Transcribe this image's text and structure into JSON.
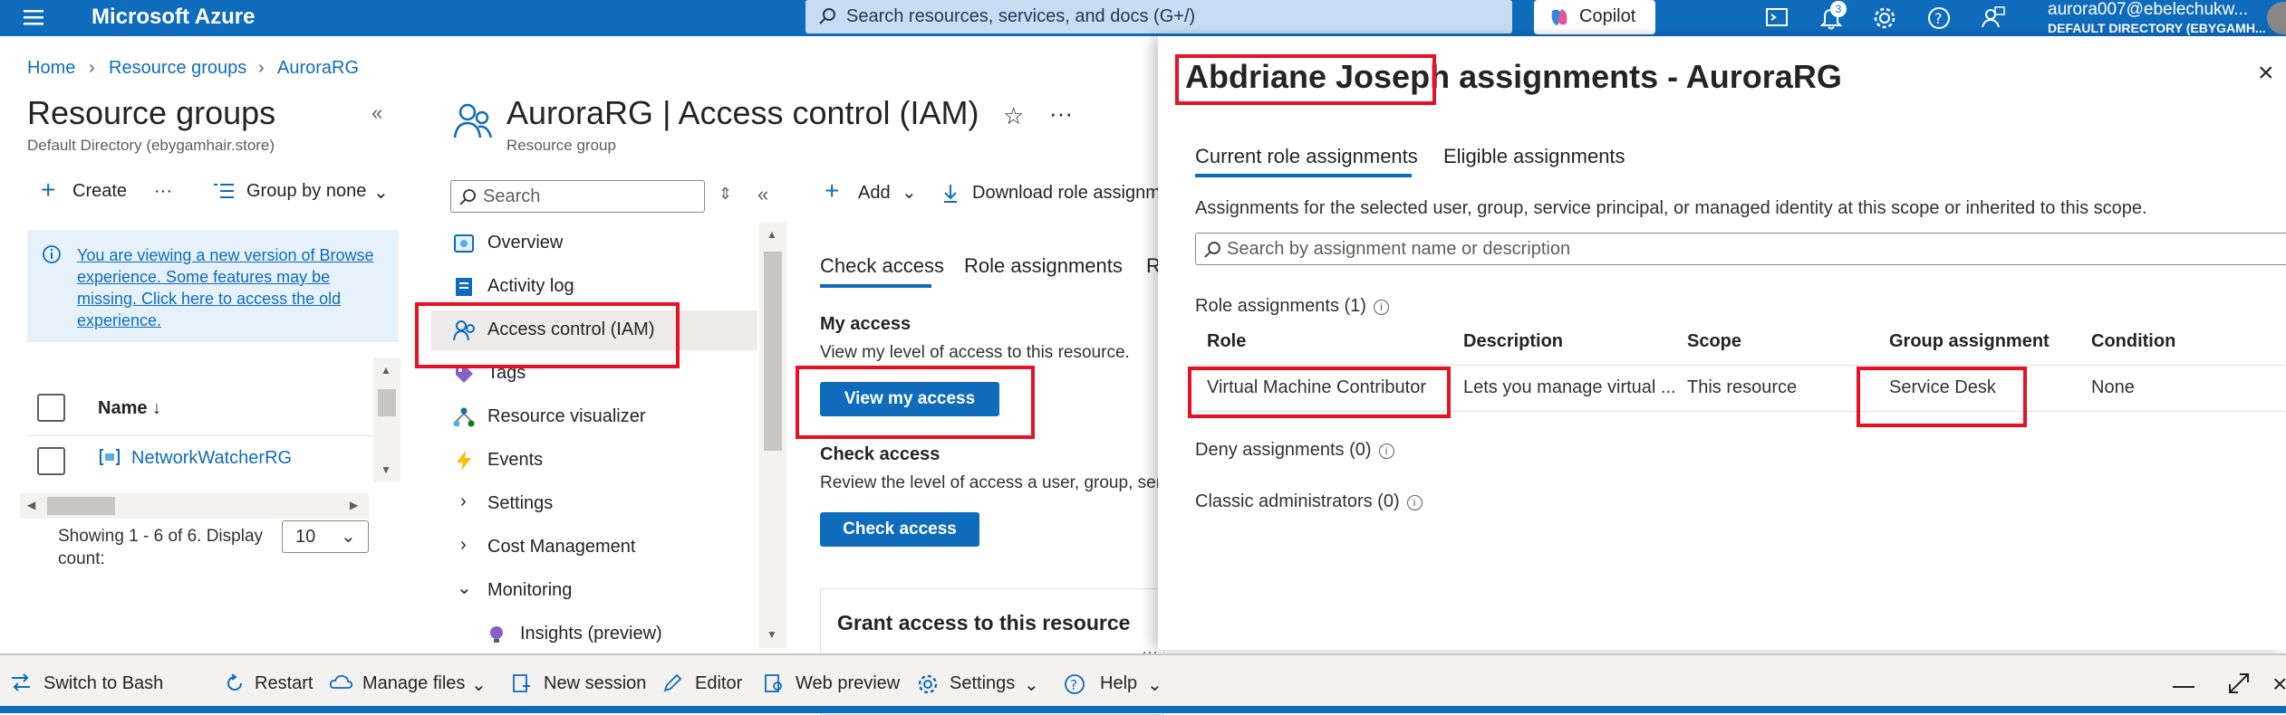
{
  "topbar": {
    "brand": "Microsoft Azure",
    "search_placeholder": "Search resources, services, and docs (G+/)",
    "copilot": "Copilot",
    "notification_count": "3",
    "account": "aurora007@ebelechukw...",
    "directory": "DEFAULT DIRECTORY (EBYGAMH..."
  },
  "breadcrumb": [
    "Home",
    "Resource groups",
    "AuroraRG"
  ],
  "left_blade": {
    "title": "Resource groups",
    "subtitle": "Default Directory (ebygamhair.store)",
    "create": "Create",
    "group_by": "Group by none",
    "info": "You are viewing a new version of Browse experience. Some features may be missing. Click here to access the old experience.",
    "col_name": "Name ↓",
    "rows": [
      "NetworkWatcherRG"
    ],
    "showing": "Showing 1 - 6 of 6. Display count:",
    "page_size": "10"
  },
  "mid_blade": {
    "title_name": "AuroraRG",
    "title_sep": " | ",
    "title_page": "Access control (IAM)",
    "subtitle": "Resource group",
    "search_placeholder": "Search",
    "nav": [
      {
        "label": "Overview"
      },
      {
        "label": "Activity log"
      },
      {
        "label": "Access control (IAM)"
      },
      {
        "label": "Tags"
      },
      {
        "label": "Resource visualizer"
      },
      {
        "label": "Events"
      },
      {
        "label": "Settings"
      },
      {
        "label": "Cost Management"
      },
      {
        "label": "Monitoring"
      },
      {
        "label": "Insights (preview)"
      }
    ]
  },
  "content": {
    "add": "Add",
    "download": "Download role assignme",
    "tabs": [
      "Check access",
      "Role assignments",
      "R"
    ],
    "my_access_h": "My access",
    "my_access_t": "View my level of access to this resource.",
    "view_btn": "View my access",
    "check_h": "Check access",
    "check_t": "Review the level of access a user, group, ser",
    "check_btn": "Check access",
    "grant": "Grant access to this resource"
  },
  "panel": {
    "title_name": "Abdriane Joseph",
    "title_rest": " assignments - AuroraRG",
    "tabs": [
      "Current role assignments",
      "Eligible assignments"
    ],
    "desc": "Assignments for the selected user, group, service principal, or managed identity at this scope or inherited to this scope.",
    "search_placeholder": "Search by assignment name or description",
    "role_assignments": "Role assignments (1)",
    "columns": [
      "Role",
      "Description",
      "Scope",
      "Group assignment",
      "Condition"
    ],
    "row": {
      "role": "Virtual Machine Contributor",
      "description": "Lets you manage virtual ...",
      "scope": "This resource",
      "group": "Service Desk",
      "condition": "None"
    },
    "deny": "Deny assignments (0)",
    "classic": "Classic administrators (0)"
  },
  "shell": {
    "switch": "Switch to Bash",
    "restart": "Restart",
    "manage_files": "Manage files",
    "new_session": "New session",
    "editor": "Editor",
    "web_preview": "Web preview",
    "settings": "Settings",
    "help": "Help"
  },
  "colors": {
    "azure_blue": "#0f6cbd",
    "highlight_red": "#e81123"
  }
}
